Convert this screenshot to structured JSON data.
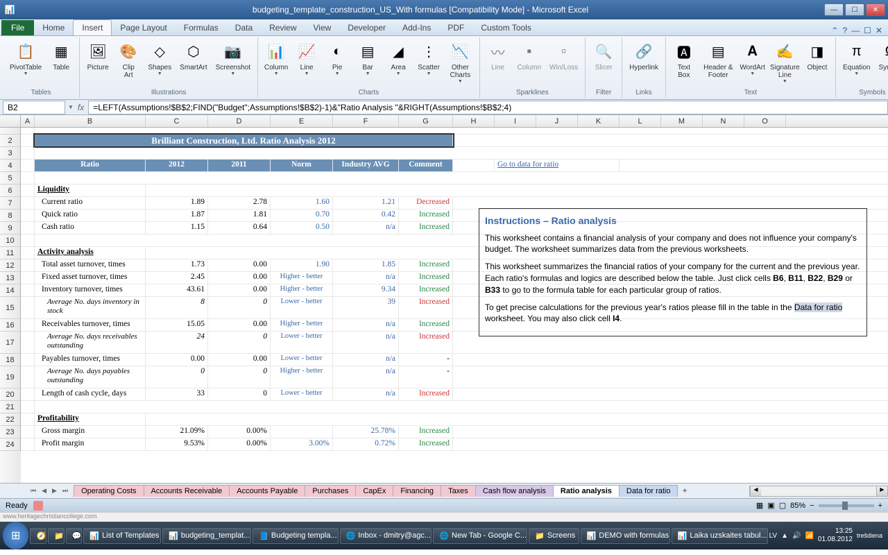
{
  "window": {
    "title": "budgeting_template_construction_US_With formulas  [Compatibility Mode] - Microsoft Excel"
  },
  "ribbon": {
    "file": "File",
    "tabs": [
      "Home",
      "Insert",
      "Page Layout",
      "Formulas",
      "Data",
      "Review",
      "View",
      "Developer",
      "Add-Ins",
      "PDF",
      "Custom Tools"
    ],
    "active_tab": "Insert",
    "groups": {
      "tables": {
        "label": "Tables",
        "items": [
          "PivotTable",
          "Table"
        ]
      },
      "illustrations": {
        "label": "Illustrations",
        "items": [
          "Picture",
          "Clip Art",
          "Shapes",
          "SmartArt",
          "Screenshot"
        ]
      },
      "charts": {
        "label": "Charts",
        "items": [
          "Column",
          "Line",
          "Pie",
          "Bar",
          "Area",
          "Scatter",
          "Other Charts"
        ]
      },
      "sparklines": {
        "label": "Sparklines",
        "items": [
          "Line",
          "Column",
          "Win/Loss"
        ]
      },
      "filter": {
        "label": "Filter",
        "items": [
          "Slicer"
        ]
      },
      "links": {
        "label": "Links",
        "items": [
          "Hyperlink"
        ]
      },
      "text": {
        "label": "Text",
        "items": [
          "Text Box",
          "Header & Footer",
          "WordArt",
          "Signature Line",
          "Object"
        ]
      },
      "symbols": {
        "label": "Symbols",
        "items": [
          "Equation",
          "Symbol"
        ]
      }
    }
  },
  "formula_bar": {
    "name_box": "B2",
    "formula": "=LEFT(Assumptions!$B$2;FIND(\"Budget\";Assumptions!$B$2)-1)&\"Ratio Analysis \"&RIGHT(Assumptions!$B$2;4)"
  },
  "columns": [
    "A",
    "B",
    "C",
    "D",
    "E",
    "F",
    "G",
    "H",
    "I",
    "J",
    "K",
    "L",
    "M",
    "N",
    "O"
  ],
  "sheet": {
    "title": "Brilliant Construction, Ltd. Ratio Analysis 2012",
    "headers": {
      "ratio": "Ratio",
      "y1": "2012",
      "y2": "2011",
      "norm": "Norm",
      "avg": "Industry AVG",
      "comment": "Comment"
    },
    "goto_link": "Go to data for ratio",
    "sections": [
      {
        "name": "Liquidity",
        "rows": [
          {
            "label": "Current ratio",
            "y1": "1.89",
            "y2": "2.78",
            "norm": "1.60",
            "avg": "1.21",
            "comment": "Decreased",
            "cc": "dec"
          },
          {
            "label": "Quick ratio",
            "y1": "1.87",
            "y2": "1.81",
            "norm": "0.70",
            "avg": "0.42",
            "comment": "Increased",
            "cc": "inc"
          },
          {
            "label": "Cash ratio",
            "y1": "1.15",
            "y2": "0.64",
            "norm": "0.50",
            "avg": "n/a",
            "comment": "Increased",
            "cc": "inc"
          }
        ]
      },
      {
        "name": "Activity analysis",
        "rows": [
          {
            "label": "Total asset turnover, times",
            "y1": "1.73",
            "y2": "0.00",
            "norm": "1.90",
            "avg": "1.85",
            "comment": "Increased",
            "cc": "inc"
          },
          {
            "label": "Fixed asset turnover, times",
            "y1": "2.45",
            "y2": "0.00",
            "norm_text": "Higher - better",
            "avg": "n/a",
            "comment": "Increased",
            "cc": "inc"
          },
          {
            "label": "Inventory turnover, times",
            "y1": "43.61",
            "y2": "0.00",
            "norm_text": "Higher - better",
            "avg": "9.34",
            "comment": "Increased",
            "cc": "inc"
          },
          {
            "label": "Average No. days inventory in stock",
            "sub": true,
            "y1": "8",
            "y2": "0",
            "norm_text": "Lower - better",
            "avg": "39",
            "comment": "Increased",
            "cc": "dec"
          },
          {
            "label": "Receivables turnover, times",
            "y1": "15.05",
            "y2": "0.00",
            "norm_text": "Higher - better",
            "avg": "n/a",
            "comment": "Increased",
            "cc": "inc"
          },
          {
            "label": "Average No. days receivables outstanding",
            "sub": true,
            "y1": "24",
            "y2": "0",
            "norm_text": "Lower - better",
            "avg": "n/a",
            "comment": "Increased",
            "cc": "dec"
          },
          {
            "label": "Payables turnover, times",
            "y1": "0.00",
            "y2": "0.00",
            "norm_text": "Lower - better",
            "avg": "n/a",
            "comment": "-",
            "cc": "dash"
          },
          {
            "label": "Average No. days payables outstanding",
            "sub": true,
            "y1": "0",
            "y2": "0",
            "norm_text": "Higher - better",
            "avg": "n/a",
            "comment": "-",
            "cc": "dash"
          },
          {
            "label": "Length of cash cycle, days",
            "y1": "33",
            "y2": "0",
            "norm_text": "Lower - better",
            "avg": "n/a",
            "comment": "Increased",
            "cc": "dec"
          }
        ]
      },
      {
        "name": "Profitability",
        "rows": [
          {
            "label": "Gross margin",
            "y1": "21.09%",
            "y2": "0.00%",
            "norm": "",
            "avg": "25.78%",
            "comment": "Increased",
            "cc": "inc"
          },
          {
            "label": "Profit margin",
            "y1": "9.53%",
            "y2": "0.00%",
            "norm": "3.00%",
            "avg": "0.72%",
            "comment": "Increased",
            "cc": "inc"
          }
        ]
      }
    ],
    "instructions": {
      "heading": "Instructions – Ratio analysis",
      "p1": "This worksheet contains a financial analysis of your company and does not influence your company's budget. The worksheet summarizes data from the previous worksheets.",
      "p2a": "This worksheet summarizes the financial ratios of your company for the current and the previous year. Each ratio's formulas and logics are described below the table. Just click cells ",
      "p2b": "B6",
      "p2c": ", ",
      "p2d": "B11",
      "p2e": ", ",
      "p2f": "B22",
      "p2g": ", ",
      "p2h": "B29",
      "p2i": " or ",
      "p2j": "B33",
      "p2k": " to go to the formula table for each particular group of ratios.",
      "p3a": "To get precise calculations for the previous year's ratios please fill in the table in the ",
      "p3b": "Data for ratio",
      "p3c": " worksheet. You may also click cell ",
      "p3d": "I4",
      "p3e": "."
    }
  },
  "sheet_tabs": [
    "Operating Costs",
    "Accounts Receivable",
    "Accounts Payable",
    "Purchases",
    "CapEx",
    "Financing",
    "Taxes",
    "Cash flow analysis",
    "Ratio analysis",
    "Data for ratio"
  ],
  "active_sheet": "Ratio analysis",
  "status": {
    "ready": "Ready",
    "zoom": "85%"
  },
  "taskbar": {
    "items": [
      "",
      "",
      "",
      "List of Templates",
      "budgeting_templat...",
      "Budgeting templa...",
      "Inbox - dmitry@agc...",
      "New Tab - Google C...",
      "Screens",
      "DEMO with formulas",
      "Laika uzskaites tabul..."
    ],
    "lang": "LV",
    "time": "13:25",
    "date": "01.08.2012",
    "day": "trešdiena"
  },
  "url": "www.heritagechristiancollege.com"
}
